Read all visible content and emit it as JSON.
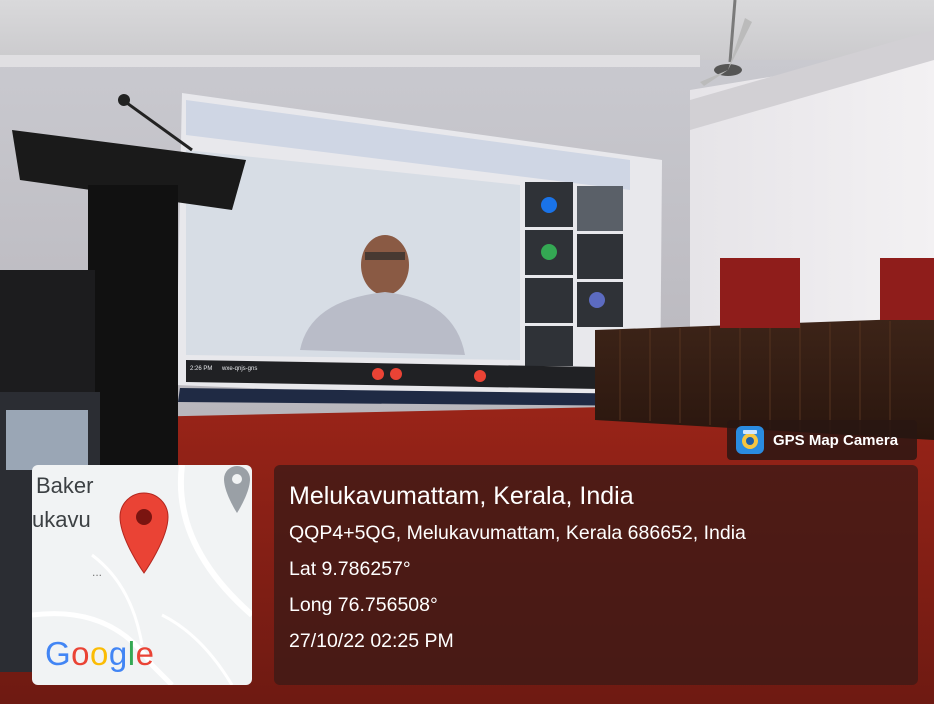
{
  "overlay": {
    "app_badge": "GPS Map Camera",
    "location_title": "Melukavumattam, Kerala, India",
    "address": "QQP4+5QG, Melukavumattam, Kerala 686652, India",
    "latitude": "Lat 9.786257°",
    "longitude": "Long 76.756508°",
    "datetime": "27/10/22 02:25 PM"
  },
  "map": {
    "label_line1": "Baker",
    "label_line2": "ukavu",
    "ellipsis": "...",
    "logo_letters": [
      "G",
      "o",
      "o",
      "g",
      "l",
      "e"
    ],
    "logo_colors": [
      "#4285F4",
      "#EA4335",
      "#FBBC05",
      "#4285F4",
      "#34A853",
      "#EA4335"
    ],
    "pin_color": "#EA4335"
  },
  "projected_screen": {
    "clock": "2:26 PM",
    "meeting_code": "wxe-qnjs-gns"
  }
}
